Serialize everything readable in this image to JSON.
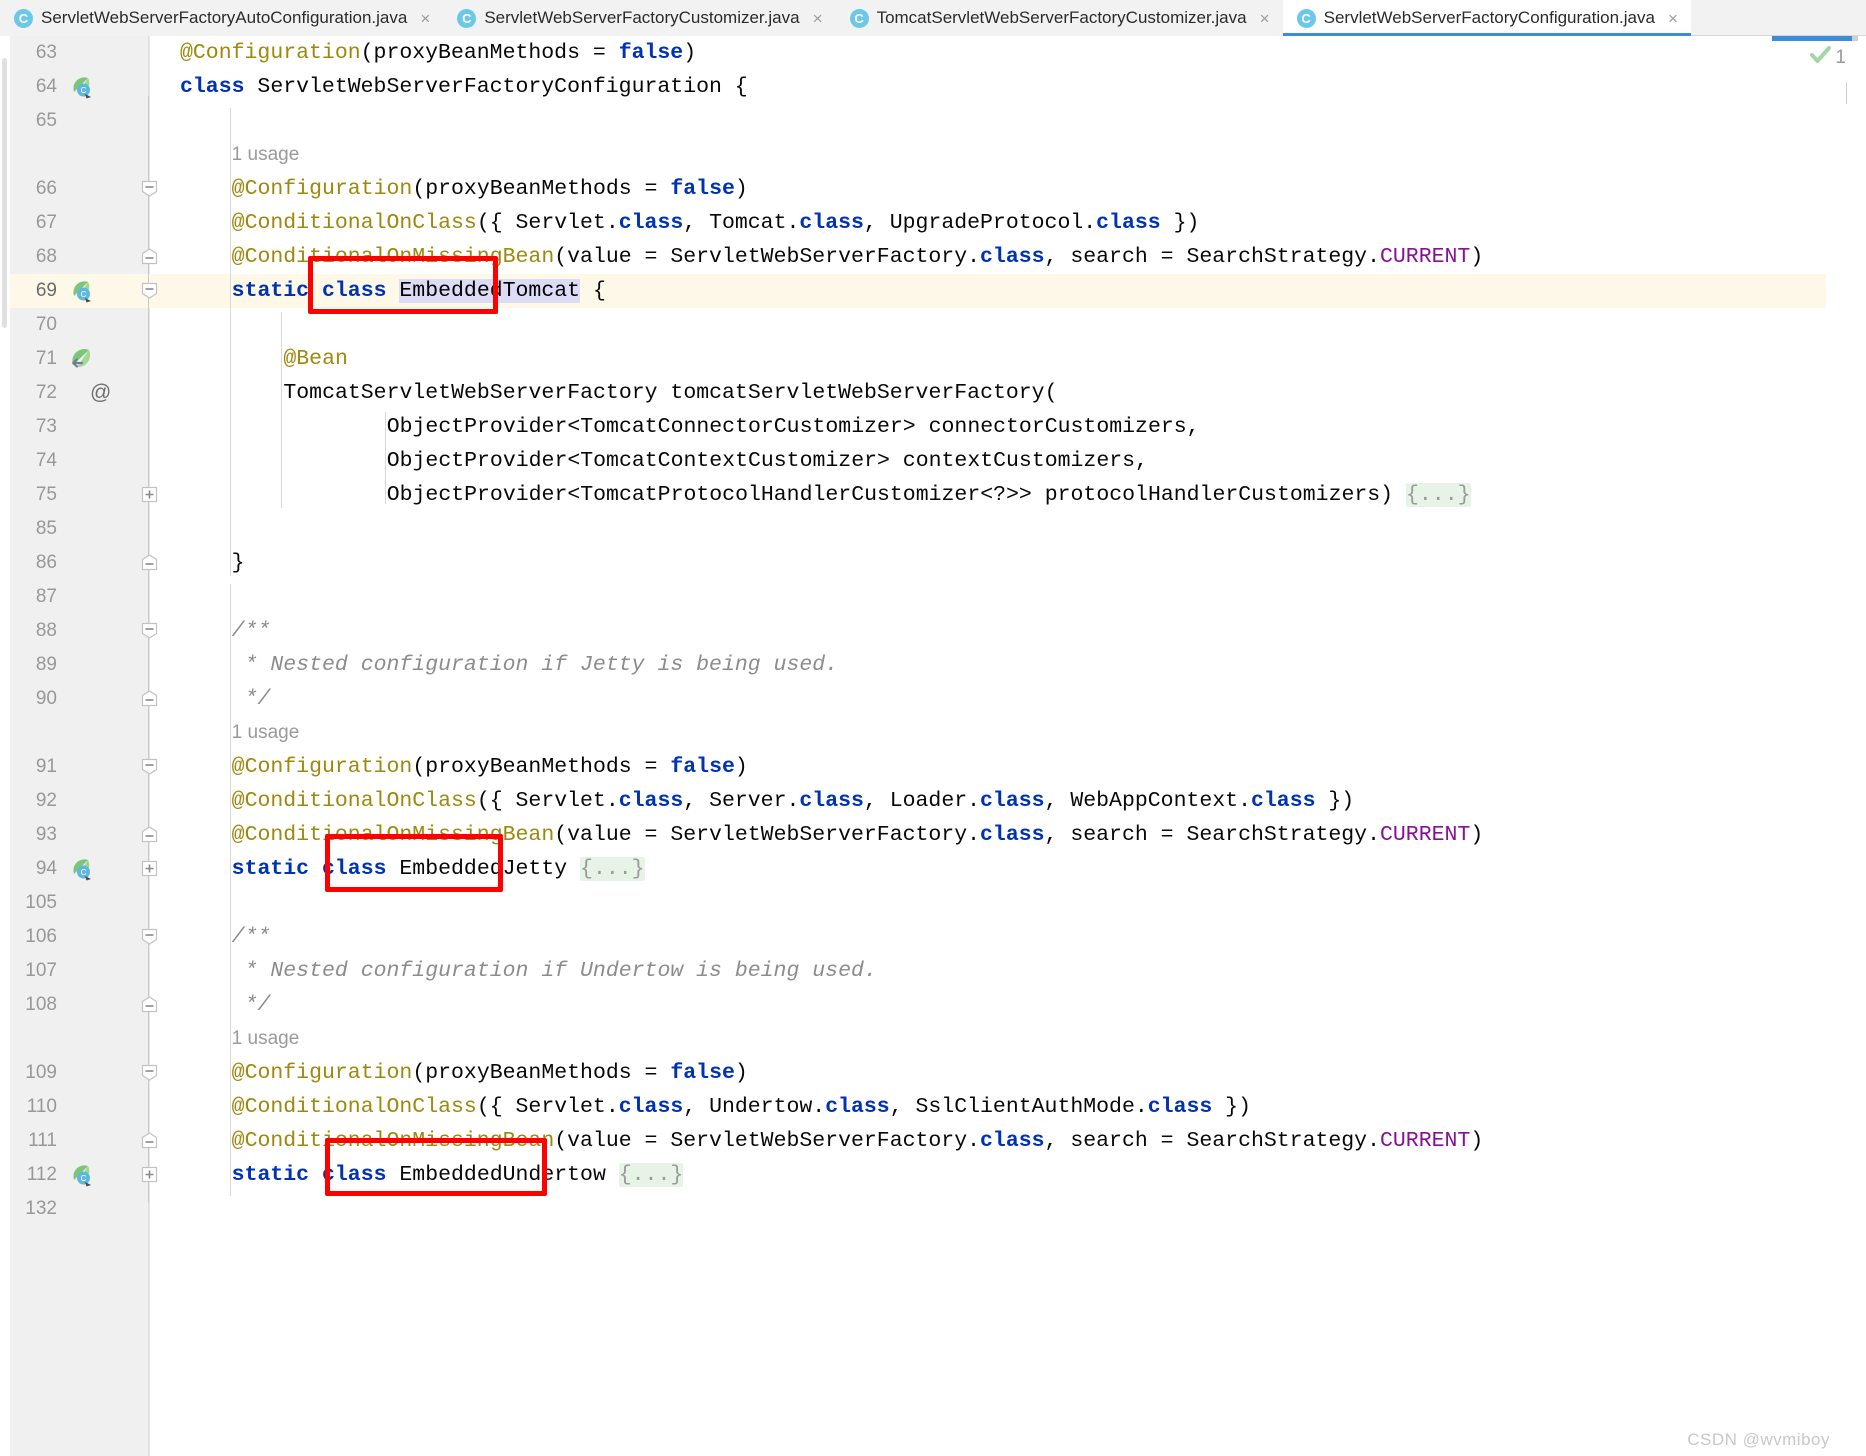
{
  "window": {
    "app": "IntelliJ IDEA editor",
    "watermark": "CSDN @wvmiboy"
  },
  "tabs": [
    {
      "icon": "java-class-icon",
      "label": "ServletWebServerFactoryAutoConfiguration.java",
      "close": "×",
      "active": false
    },
    {
      "icon": "java-class-icon",
      "label": "ServletWebServerFactoryCustomizer.java",
      "close": "×",
      "active": false
    },
    {
      "icon": "java-class-icon",
      "label": "TomcatServletWebServerFactoryCustomizer.java",
      "close": "×",
      "active": false
    },
    {
      "icon": "java-class-icon",
      "label": "ServletWebServerFactoryConfiguration.java",
      "close": "×",
      "active": true
    }
  ],
  "inspection": {
    "status_icon": "green-check-icon",
    "count": "1"
  },
  "gutter": {
    "line_numbers": [
      "63",
      "64",
      "65",
      "66",
      "67",
      "68",
      "69",
      "70",
      "71",
      "72",
      "73",
      "74",
      "75",
      "85",
      "86",
      "87",
      "88",
      "89",
      "90",
      "91",
      "92",
      "93",
      "94",
      "105",
      "106",
      "107",
      "108",
      "109",
      "110",
      "111",
      "112",
      "132"
    ],
    "markers": [
      {
        "line": "64",
        "icon": "run-bean-gutter-icon"
      },
      {
        "line": "69",
        "icon": "run-bean-gutter-icon"
      },
      {
        "line": "71",
        "icon": "bean-dependency-gutter-icon"
      },
      {
        "line": "72",
        "icon": "annotation-gutter-icon",
        "glyph": "@"
      },
      {
        "line": "94",
        "icon": "run-bean-gutter-icon"
      },
      {
        "line": "112",
        "icon": "run-bean-gutter-icon"
      }
    ]
  },
  "inlay_hints": [
    {
      "line": "65",
      "text": "1 usage"
    },
    {
      "line": "90",
      "text": "1 usage"
    },
    {
      "line": "108",
      "text": "1 usage"
    }
  ],
  "code": {
    "lines": [
      {
        "n": "63",
        "segments": [
          {
            "t": "@Configuration",
            "c": "ann"
          },
          {
            "t": "(proxyBeanMethods = ",
            "c": "plain"
          },
          {
            "t": "false",
            "c": "kw"
          },
          {
            "t": ")",
            "c": "plain"
          }
        ]
      },
      {
        "n": "64",
        "segments": [
          {
            "t": "class ",
            "c": "kw"
          },
          {
            "t": "ServletWebServerFactoryConfiguration {",
            "c": "plain"
          }
        ]
      },
      {
        "n": "65",
        "segments": []
      },
      {
        "n": "66",
        "segments": [
          {
            "t": "@Configuration",
            "c": "ann"
          },
          {
            "t": "(proxyBeanMethods = ",
            "c": "plain"
          },
          {
            "t": "false",
            "c": "kw"
          },
          {
            "t": ")",
            "c": "plain"
          }
        ]
      },
      {
        "n": "67",
        "segments": [
          {
            "t": "@ConditionalOnClass",
            "c": "ann"
          },
          {
            "t": "({ Servlet.",
            "c": "plain"
          },
          {
            "t": "class",
            "c": "kw"
          },
          {
            "t": ", Tomcat.",
            "c": "plain"
          },
          {
            "t": "class",
            "c": "kw"
          },
          {
            "t": ", UpgradeProtocol.",
            "c": "plain"
          },
          {
            "t": "class",
            "c": "kw"
          },
          {
            "t": " })",
            "c": "plain"
          }
        ]
      },
      {
        "n": "68",
        "segments": [
          {
            "t": "@ConditionalOnMissingBean",
            "c": "ann"
          },
          {
            "t": "(value = ServletWebServerFactory.",
            "c": "plain"
          },
          {
            "t": "class",
            "c": "kw"
          },
          {
            "t": ", search = SearchStrategy.",
            "c": "plain"
          },
          {
            "t": "CURRENT",
            "c": "stat"
          },
          {
            "t": ")",
            "c": "plain"
          }
        ]
      },
      {
        "n": "69",
        "segments": [
          {
            "t": "static class ",
            "c": "kw"
          },
          {
            "t": "EmbeddedTomcat",
            "c": "idsel"
          },
          {
            "t": " {",
            "c": "plain"
          }
        ]
      },
      {
        "n": "70",
        "segments": []
      },
      {
        "n": "71",
        "segments": [
          {
            "t": "@Bean",
            "c": "ann"
          }
        ]
      },
      {
        "n": "72",
        "segments": [
          {
            "t": "TomcatServletWebServerFactory tomcatServletWebServerFactory(",
            "c": "plain"
          }
        ]
      },
      {
        "n": "73",
        "segments": [
          {
            "t": "ObjectProvider<TomcatConnectorCustomizer> connectorCustomizers,",
            "c": "plain"
          }
        ]
      },
      {
        "n": "74",
        "segments": [
          {
            "t": "ObjectProvider<TomcatContextCustomizer> contextCustomizers,",
            "c": "plain"
          }
        ]
      },
      {
        "n": "75",
        "segments": [
          {
            "t": "ObjectProvider<TomcatProtocolHandlerCustomizer<?>> protocolHandlerCustomizers) ",
            "c": "plain"
          },
          {
            "t": "{...}",
            "c": "fold"
          }
        ]
      },
      {
        "n": "85",
        "segments": []
      },
      {
        "n": "86",
        "segments": [
          {
            "t": "}",
            "c": "plain"
          }
        ]
      },
      {
        "n": "87",
        "segments": []
      },
      {
        "n": "88",
        "segments": [
          {
            "t": "/**",
            "c": "cmt"
          }
        ]
      },
      {
        "n": "89",
        "segments": [
          {
            "t": " * Nested configuration if Jetty is being used.",
            "c": "cmt"
          }
        ]
      },
      {
        "n": "90",
        "segments": [
          {
            "t": " */",
            "c": "cmt"
          }
        ]
      },
      {
        "n": "91",
        "segments": [
          {
            "t": "@Configuration",
            "c": "ann"
          },
          {
            "t": "(proxyBeanMethods = ",
            "c": "plain"
          },
          {
            "t": "false",
            "c": "kw"
          },
          {
            "t": ")",
            "c": "plain"
          }
        ]
      },
      {
        "n": "92",
        "segments": [
          {
            "t": "@ConditionalOnClass",
            "c": "ann"
          },
          {
            "t": "({ Servlet.",
            "c": "plain"
          },
          {
            "t": "class",
            "c": "kw"
          },
          {
            "t": ", Server.",
            "c": "plain"
          },
          {
            "t": "class",
            "c": "kw"
          },
          {
            "t": ", Loader.",
            "c": "plain"
          },
          {
            "t": "class",
            "c": "kw"
          },
          {
            "t": ", WebAppContext.",
            "c": "plain"
          },
          {
            "t": "class",
            "c": "kw"
          },
          {
            "t": " })",
            "c": "plain"
          }
        ]
      },
      {
        "n": "93",
        "segments": [
          {
            "t": "@ConditionalOnMissingBean",
            "c": "ann"
          },
          {
            "t": "(value = ServletWebServerFactory.",
            "c": "plain"
          },
          {
            "t": "class",
            "c": "kw"
          },
          {
            "t": ", search = SearchStrategy.",
            "c": "plain"
          },
          {
            "t": "CURRENT",
            "c": "stat"
          },
          {
            "t": ")",
            "c": "plain"
          }
        ]
      },
      {
        "n": "94",
        "segments": [
          {
            "t": "static class ",
            "c": "kw"
          },
          {
            "t": "EmbeddedJetty ",
            "c": "plain"
          },
          {
            "t": "{...}",
            "c": "fold"
          }
        ]
      },
      {
        "n": "105",
        "segments": []
      },
      {
        "n": "106",
        "segments": [
          {
            "t": "/**",
            "c": "cmt"
          }
        ]
      },
      {
        "n": "107",
        "segments": [
          {
            "t": " * Nested configuration if Undertow is being used.",
            "c": "cmt"
          }
        ]
      },
      {
        "n": "108",
        "segments": [
          {
            "t": " */",
            "c": "cmt"
          }
        ]
      },
      {
        "n": "109",
        "segments": [
          {
            "t": "@Configuration",
            "c": "ann"
          },
          {
            "t": "(proxyBeanMethods = ",
            "c": "plain"
          },
          {
            "t": "false",
            "c": "kw"
          },
          {
            "t": ")",
            "c": "plain"
          }
        ]
      },
      {
        "n": "110",
        "segments": [
          {
            "t": "@ConditionalOnClass",
            "c": "ann"
          },
          {
            "t": "({ Servlet.",
            "c": "plain"
          },
          {
            "t": "class",
            "c": "kw"
          },
          {
            "t": ", Undertow.",
            "c": "plain"
          },
          {
            "t": "class",
            "c": "kw"
          },
          {
            "t": ", SslClientAuthMode.",
            "c": "plain"
          },
          {
            "t": "class",
            "c": "kw"
          },
          {
            "t": " })",
            "c": "plain"
          }
        ]
      },
      {
        "n": "111",
        "segments": [
          {
            "t": "@ConditionalOnMissingBean",
            "c": "ann"
          },
          {
            "t": "(value = ServletWebServerFactory.",
            "c": "plain"
          },
          {
            "t": "class",
            "c": "kw"
          },
          {
            "t": ", search = SearchStrategy.",
            "c": "plain"
          },
          {
            "t": "CURRENT",
            "c": "stat"
          },
          {
            "t": ")",
            "c": "plain"
          }
        ]
      },
      {
        "n": "112",
        "segments": [
          {
            "t": "static class ",
            "c": "kw"
          },
          {
            "t": "EmbeddedUndertow ",
            "c": "plain"
          },
          {
            "t": "{...}",
            "c": "fold"
          }
        ]
      },
      {
        "n": "132",
        "segments": []
      }
    ]
  },
  "annotations": [
    {
      "name": "highlight-embedded-tomcat",
      "target": "EmbeddedTomcat"
    },
    {
      "name": "highlight-embedded-jetty",
      "target": "EmbeddedJetty"
    },
    {
      "name": "highlight-embedded-undertow",
      "target": "EmbeddedUndertow"
    }
  ],
  "colors": {
    "annotation": "#9e880d",
    "keyword": "#0033b3",
    "comment": "#8c8c8c",
    "static_field": "#871094",
    "highlight_line": "#fdf8e7",
    "identifier_selection": "#dcdcf7",
    "folded_block": "#e7f3e7",
    "red_box": "#ff0000",
    "tab_active_underline": "#3c8dd9"
  }
}
